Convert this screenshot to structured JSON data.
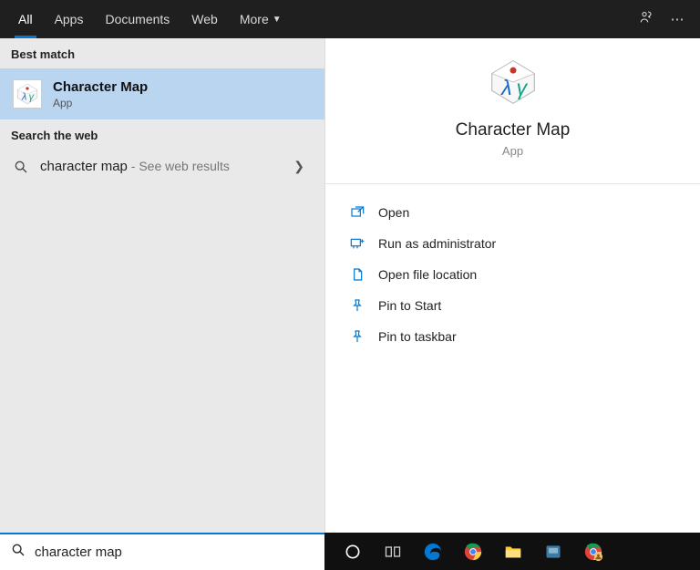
{
  "tabs": {
    "all": "All",
    "apps": "Apps",
    "documents": "Documents",
    "web": "Web",
    "more": "More"
  },
  "left": {
    "best_match_header": "Best match",
    "best_match": {
      "title": "Character Map",
      "subtitle": "App"
    },
    "search_web_header": "Search the web",
    "web_result": {
      "query": "character map",
      "suffix": " - See web results"
    }
  },
  "details": {
    "title": "Character Map",
    "subtitle": "App",
    "actions": {
      "open": "Open",
      "run_admin": "Run as administrator",
      "open_location": "Open file location",
      "pin_start": "Pin to Start",
      "pin_taskbar": "Pin to taskbar"
    }
  },
  "search": {
    "value": "character map"
  }
}
